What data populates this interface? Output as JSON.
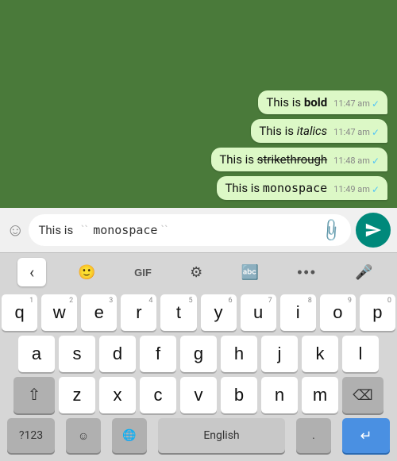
{
  "chat": {
    "background": "#4a7a3a",
    "messages": [
      {
        "text_prefix": "This is ",
        "text_styled": "bold",
        "style": "bold",
        "time": "11:47 am",
        "read": true
      },
      {
        "text_prefix": "This is ",
        "text_styled": "italics",
        "style": "italic",
        "time": "11:47 am",
        "read": true
      },
      {
        "text_prefix": "This is ",
        "text_styled": "strikethrough",
        "style": "strikethrough",
        "time": "11:48 am",
        "read": true
      },
      {
        "text_prefix": "This is ",
        "text_styled": "monospace",
        "style": "monospace",
        "time": "11:49 am",
        "read": true
      }
    ]
  },
  "input": {
    "prefix": "This is",
    "monospace_text": "monospace",
    "placeholder": ""
  },
  "toolbar": {
    "gif_label": "GIF",
    "dots_label": "•••"
  },
  "keyboard": {
    "rows": [
      [
        {
          "label": "q",
          "number": "1"
        },
        {
          "label": "w",
          "number": "2"
        },
        {
          "label": "e",
          "number": "3"
        },
        {
          "label": "r",
          "number": "4"
        },
        {
          "label": "t",
          "number": "5"
        },
        {
          "label": "y",
          "number": "6"
        },
        {
          "label": "u",
          "number": "7"
        },
        {
          "label": "i",
          "number": "8"
        },
        {
          "label": "o",
          "number": "9"
        },
        {
          "label": "p",
          "number": "0"
        }
      ],
      [
        {
          "label": "a"
        },
        {
          "label": "s"
        },
        {
          "label": "d"
        },
        {
          "label": "f"
        },
        {
          "label": "g"
        },
        {
          "label": "h"
        },
        {
          "label": "j"
        },
        {
          "label": "k"
        },
        {
          "label": "l"
        }
      ],
      [
        {
          "label": "⇧",
          "special": "shift"
        },
        {
          "label": "z"
        },
        {
          "label": "x"
        },
        {
          "label": "c"
        },
        {
          "label": "v"
        },
        {
          "label": "b"
        },
        {
          "label": "n"
        },
        {
          "label": "m"
        },
        {
          "label": "⌫",
          "special": "backspace"
        }
      ]
    ],
    "bottom": {
      "num_label": "?123",
      "emoji_label": "☺",
      "globe_label": "🌐",
      "lang_label": "English",
      "dot_label": ".",
      "return_label": "↵"
    }
  }
}
